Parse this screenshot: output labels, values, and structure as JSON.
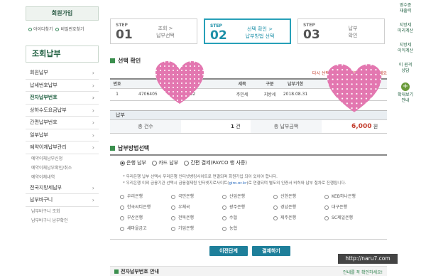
{
  "sidebar": {
    "join": "회원가입",
    "find_id": "아이디찾기",
    "find_pw": "비밀번호찾기",
    "title": "조회납부",
    "menu": [
      {
        "label": "회원납부",
        "chev": "›"
      },
      {
        "label": "납세번호납부",
        "chev": "›"
      },
      {
        "label": "전자납부번호",
        "chev": "›"
      },
      {
        "label": "상하수도요금납부",
        "chev": "›"
      },
      {
        "label": "간편납부번호",
        "chev": "›"
      },
      {
        "label": "일부납부",
        "chev": "›"
      },
      {
        "label": "예약이체납부관리",
        "chev": "›"
      }
    ],
    "submenu": [
      "예약이체납부신청",
      "예약이체납부확인/취소",
      "예약이체내역"
    ],
    "menu2": [
      {
        "label": "전국지방세납부",
        "chev": "›"
      },
      {
        "label": "납부바구니",
        "chev": "›"
      }
    ],
    "submenu2": [
      "납부바구니 조회",
      "납부바구니 납부확인"
    ]
  },
  "quick_menu": [
    {
      "label": "영수증\n재출력"
    },
    {
      "label": "지방세\n미리계산"
    },
    {
      "label": "지방세\n이익계산"
    },
    {
      "label": "이 원격\n상담"
    }
  ],
  "quick_expand": "확대보기\n안내",
  "steps": [
    {
      "num_label": "STEP",
      "num": "01",
      "desc_line1": "조회 >",
      "desc_line2": "납부선택"
    },
    {
      "num_label": "STEP",
      "num": "02",
      "desc_line1": "선택 확인 >",
      "desc_line2": "납부방법 선택"
    },
    {
      "num_label": "STEP",
      "num": "03",
      "desc_line1": "납부",
      "desc_line2": "확인"
    }
  ],
  "confirm": {
    "title": "선택 확인",
    "notice": "다시 선택하시려면 이전단계를 클릭하세요",
    "columns": [
      "번호",
      "",
      "세목",
      "구분",
      "납부기한",
      "체납"
    ],
    "rows": [
      [
        "1",
        "4706405",
        "110532",
        "주민세",
        "지방세",
        "2018.08.31"
      ]
    ]
  },
  "pay": {
    "head": "납부",
    "count_label": "총 건수",
    "count": "1",
    "count_unit": "건",
    "total_label": "총 납부금액",
    "total": "6,000",
    "total_unit": "원"
  },
  "method": {
    "title": "납부방법선택",
    "options": [
      "은행 납부",
      "카드 납부",
      "간편 결제(PAYCO 행 사증)"
    ],
    "note1": "우리은행 납부 선택시 우리은행 인터넷뱅킹사이트로 연결되며 회원가입 되어 있어야 합니다.",
    "note2_prefix": "우리은행 이외 금융기관 선택시 금융결제원 인터넷지로사이트(",
    "note2_link": "giro.or.kr",
    "note2_suffix": ")로 연결되며 별도의 인증서 비허와 납부 절차로 진행됩니다.",
    "banks": [
      [
        "우리은행",
        "국민은행",
        "산업은행",
        "신한은행",
        "KEB하나은행"
      ],
      [
        "한국씨티은행",
        "우체국",
        "광주은행",
        "경남은행",
        "대구은행"
      ],
      [
        "부산은행",
        "전북은행",
        "수협",
        "제주은행",
        "SC제일은행"
      ],
      [
        "새마을금고",
        "기업은행",
        "농협"
      ]
    ]
  },
  "buttons": {
    "prev": "이전단계",
    "pay": "결제하기"
  },
  "footer": {
    "left": "전자납부번호 안내",
    "right": "안내를 꼭 확인하세요!"
  },
  "watermark": "http://naru7.com",
  "colors": {
    "accent": "#1e90a8",
    "green": "#3b8f4e",
    "red": "#c23a2a",
    "heart": "#e377b0"
  }
}
